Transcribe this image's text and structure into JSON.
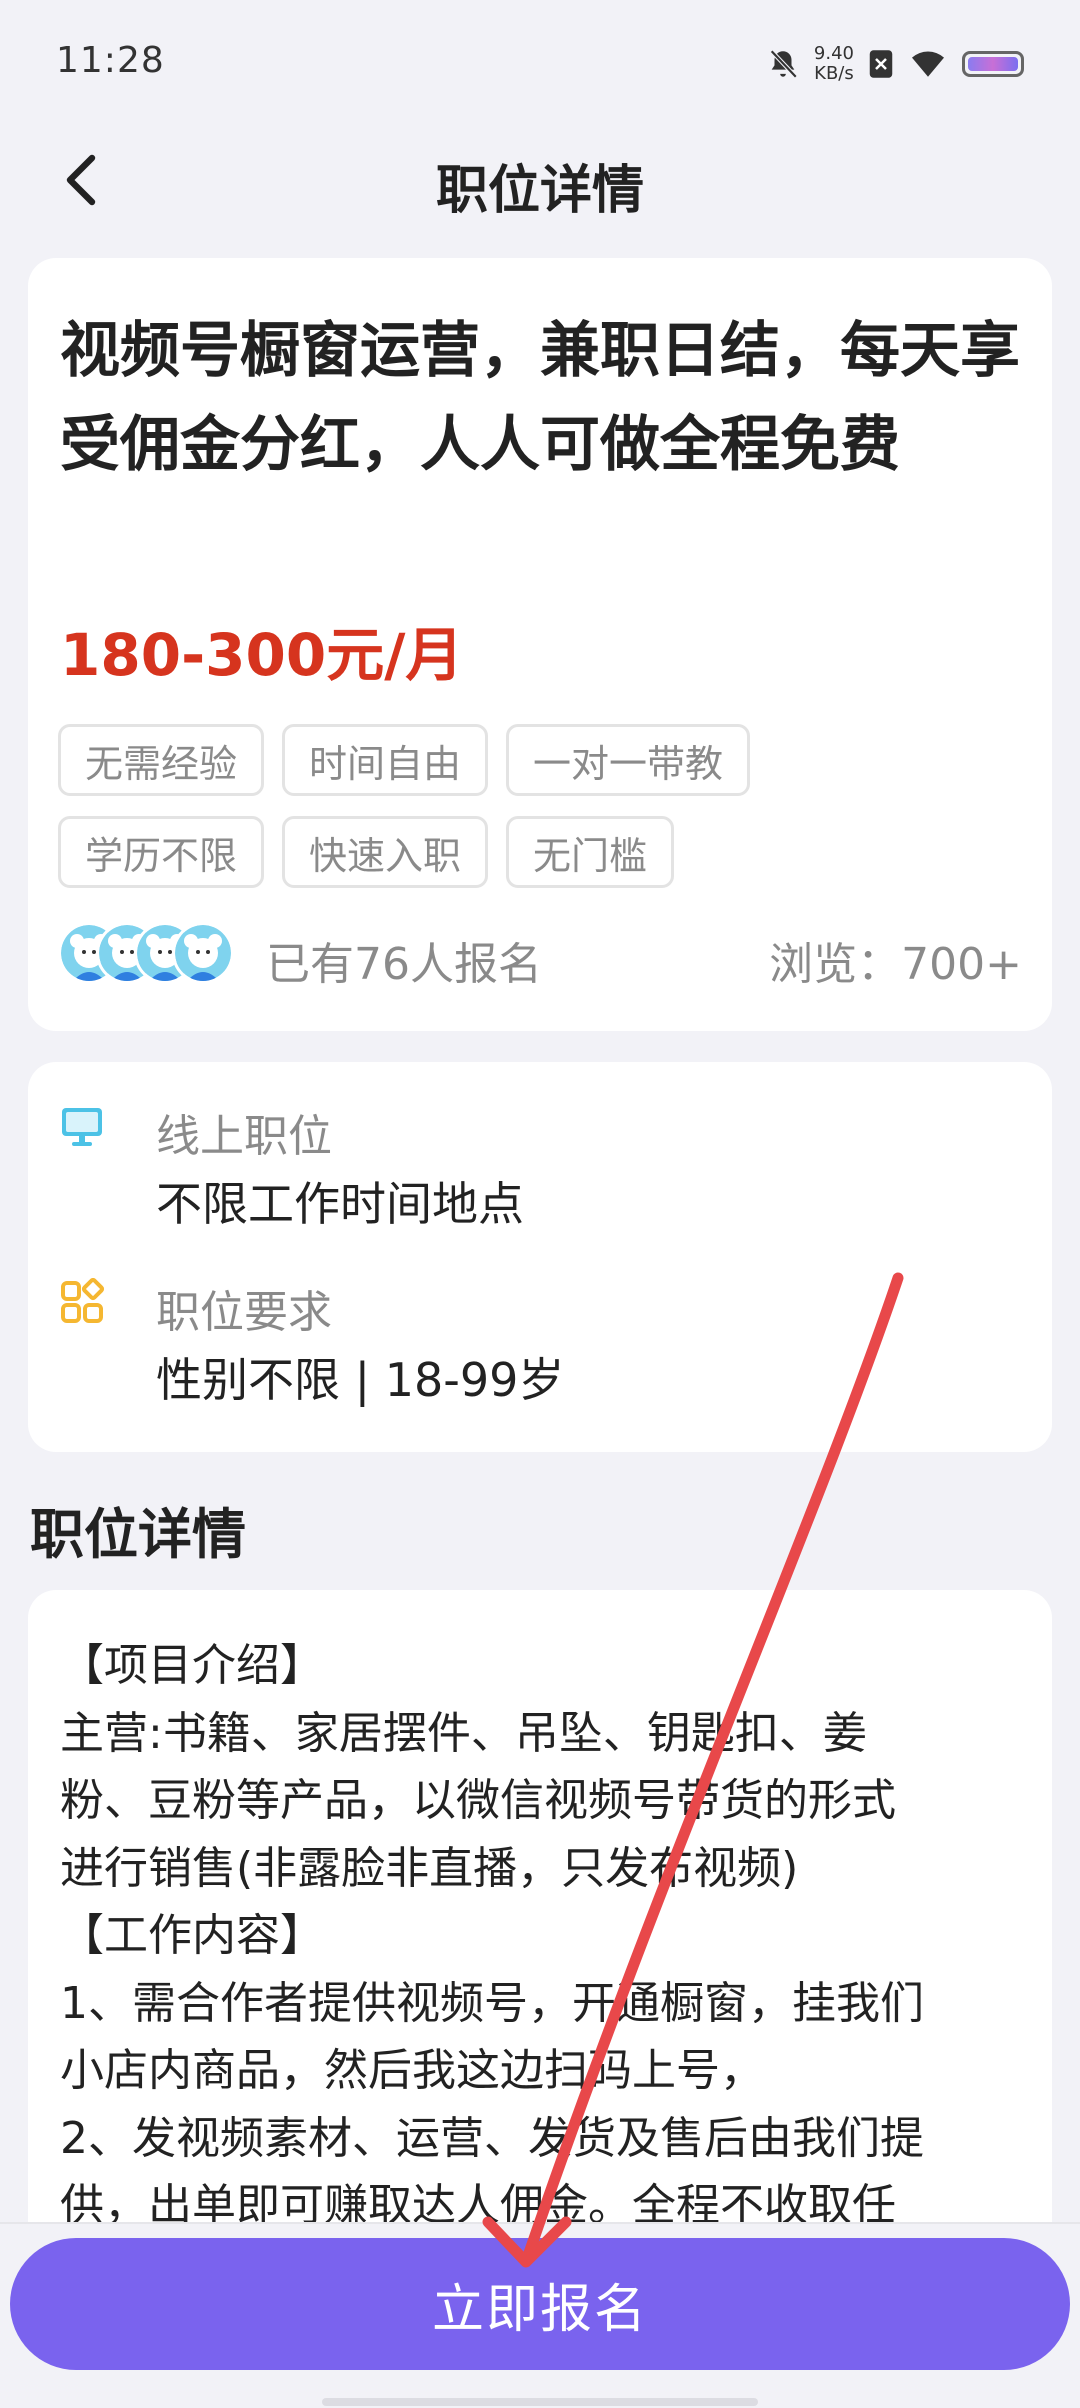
{
  "status_bar": {
    "time": "11:28",
    "net_speed_value": "9.40",
    "net_speed_unit": "KB/s",
    "icons": [
      "bell-off-icon",
      "sim-x-icon",
      "wifi-icon",
      "battery-icon"
    ]
  },
  "nav": {
    "title": "职位详情",
    "back_icon": "chevron-left-icon"
  },
  "job": {
    "title": "视频号橱窗运营，兼职日结，每天享受佣金分红，人人可做全程免费",
    "salary": "180-300元/月",
    "tags": [
      "无需经验",
      "时间自由",
      "一对一带教",
      "学历不限",
      "快速入职",
      "无门槛"
    ],
    "signup_count": "已有76人报名",
    "views": "浏览：700+"
  },
  "info": {
    "location_label": "线上职位",
    "location_value": "不限工作时间地点",
    "location_icon": "monitor-icon",
    "requirement_label": "职位要求",
    "requirement_value": "性别不限 | 18-99岁",
    "requirement_icon": "grid-icon"
  },
  "details": {
    "section_title": "职位详情",
    "lines": [
      "【项目介绍】",
      "主营:书籍、家居摆件、吊坠、钥匙扣、姜",
      "粉、豆粉等产品，以微信视频号带货的形式",
      "进行销售(非露脸非直播，只发布视频)",
      "【工作内容】",
      "1、需合作者提供视频号，开通橱窗，挂我们",
      "小店内商品，然后我这边扫码上号，",
      "2、发视频素材、运营、发货及售后由我们提",
      "供，出单即可赚取达人佣金。全程不收取任"
    ]
  },
  "apply_button": "立即报名",
  "colors": {
    "accent": "#7a63ee",
    "salary": "#d6341e",
    "annotation_arrow": "#e8484a"
  }
}
